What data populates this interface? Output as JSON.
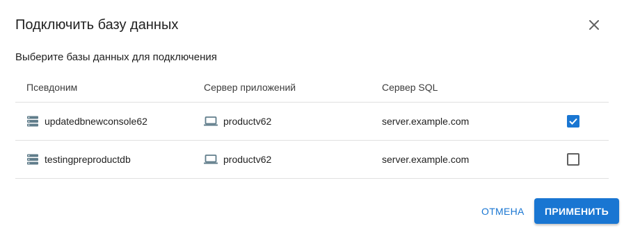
{
  "dialog": {
    "title": "Подключить базу данных",
    "subtitle": "Выберите базы данных для подключения",
    "close_icon": "close-icon"
  },
  "table": {
    "headers": {
      "alias": "Псевдоним",
      "app_server": "Сервер приложений",
      "sql_server": "Сервер SQL"
    },
    "rows": [
      {
        "alias": "updatedbnewconsole62",
        "alias_icon": "database-icon",
        "app_server": "productv62",
        "app_server_icon": "laptop-icon",
        "sql_server": "server.example.com",
        "selected": true
      },
      {
        "alias": "testingpreproductdb",
        "alias_icon": "database-icon",
        "app_server": "productv62",
        "app_server_icon": "laptop-icon",
        "sql_server": "server.example.com",
        "selected": false
      }
    ]
  },
  "actions": {
    "cancel_label": "ОТМЕНА",
    "apply_label": "ПРИМЕНИТЬ"
  },
  "colors": {
    "accent": "#1976d2",
    "text": "#212121",
    "divider": "#e0e0e0",
    "icon": "#607d8b"
  }
}
